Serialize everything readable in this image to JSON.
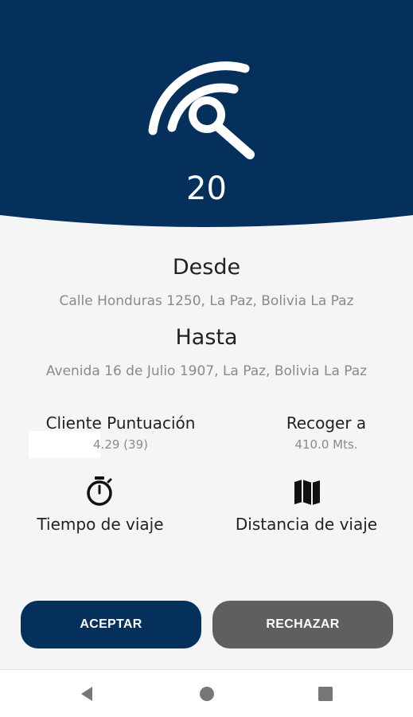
{
  "header": {
    "countdown": "20",
    "icon": "radar-search-icon",
    "color": "#05305c"
  },
  "route": {
    "from_title": "Desde",
    "from_address": "Calle Honduras 1250, La Paz, Bolivia La Paz",
    "to_title": "Hasta",
    "to_address": "Avenida 16 de Julio 1907, La Paz, Bolivia La Paz"
  },
  "info": {
    "rating_label": "Cliente Puntuación",
    "rating_value": "4.29 (39)",
    "pickup_label": "Recoger a",
    "pickup_value": "410.0 Mts."
  },
  "stats": {
    "time_label": "Tiempo de viaje",
    "time_icon": "stopwatch-icon",
    "distance_label": "Distancia de viaje",
    "distance_icon": "map-icon"
  },
  "actions": {
    "accept_label": "ACEPTAR",
    "reject_label": "RECHAZAR",
    "accept_color": "#05305c",
    "reject_color": "#5f5f5f"
  },
  "navbar": {
    "back_icon": "back-triangle-icon",
    "home_icon": "home-circle-icon",
    "recent_icon": "recents-square-icon"
  }
}
